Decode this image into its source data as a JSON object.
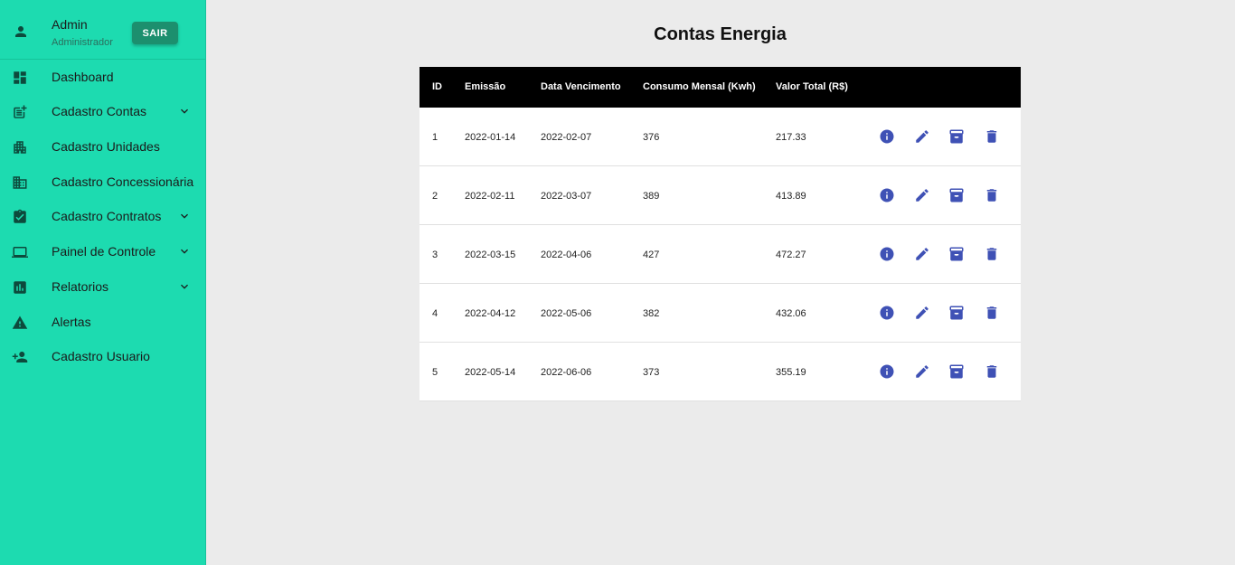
{
  "user": {
    "name": "Admin",
    "role": "Administrador",
    "logout_label": "SAIR"
  },
  "sidebar": {
    "items": [
      {
        "label": "Dashboard",
        "icon": "dashboard-icon",
        "expandable": false
      },
      {
        "label": "Cadastro Contas",
        "icon": "post-add-icon",
        "expandable": true
      },
      {
        "label": "Cadastro Unidades",
        "icon": "apartment-icon",
        "expandable": false
      },
      {
        "label": "Cadastro Concessionária",
        "icon": "domain-icon",
        "expandable": false
      },
      {
        "label": "Cadastro Contratos",
        "icon": "assignment-turned-in-icon",
        "expandable": true
      },
      {
        "label": "Painel de Controle",
        "icon": "laptop-icon",
        "expandable": true
      },
      {
        "label": "Relatorios",
        "icon": "assessment-icon",
        "expandable": true
      },
      {
        "label": "Alertas",
        "icon": "warning-icon",
        "expandable": false
      },
      {
        "label": "Cadastro Usuario",
        "icon": "person-add-icon",
        "expandable": false
      }
    ]
  },
  "main": {
    "title": "Contas Energia",
    "table": {
      "headers": [
        "ID",
        "Emissão",
        "Data Vencimento",
        "Consumo Mensal (Kwh)",
        "Valor Total (R$)"
      ],
      "rows": [
        [
          "1",
          "2022-01-14",
          "2022-02-07",
          "376",
          "217.33"
        ],
        [
          "2",
          "2022-02-11",
          "2022-03-07",
          "389",
          "413.89"
        ],
        [
          "3",
          "2022-03-15",
          "2022-04-06",
          "427",
          "472.27"
        ],
        [
          "4",
          "2022-04-12",
          "2022-05-06",
          "382",
          "432.06"
        ],
        [
          "5",
          "2022-05-14",
          "2022-06-06",
          "373",
          "355.19"
        ]
      ],
      "row_actions": [
        "info-icon",
        "edit-icon",
        "archive-icon",
        "delete-icon"
      ]
    }
  },
  "colors": {
    "sidebar_bg": "#1ddbb0",
    "sidebar_icon": "#0d4a3c",
    "logout_bg": "#1c8f6e",
    "action_icon": "#3f51b5",
    "table_header_bg": "#000000",
    "page_bg": "#ebebeb"
  }
}
